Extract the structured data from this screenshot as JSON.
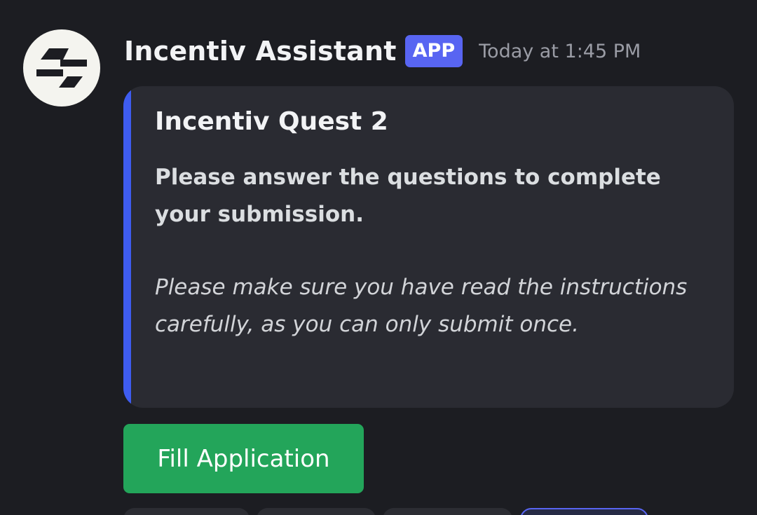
{
  "message": {
    "author": "Incentiv Assistant",
    "badge": "APP",
    "timestamp": "Today at 1:45 PM",
    "avatar_icon": "incentiv-logo-icon"
  },
  "embed": {
    "title": "Incentiv Quest 2",
    "description": "Please answer the questions to complete your submission.",
    "note": "Please make sure you have read the instructions carefully, as you can only submit once.",
    "accent_color": "#3e5cf0"
  },
  "actions": {
    "fill_button_label": "Fill Application",
    "fill_button_color": "#23a55a"
  }
}
